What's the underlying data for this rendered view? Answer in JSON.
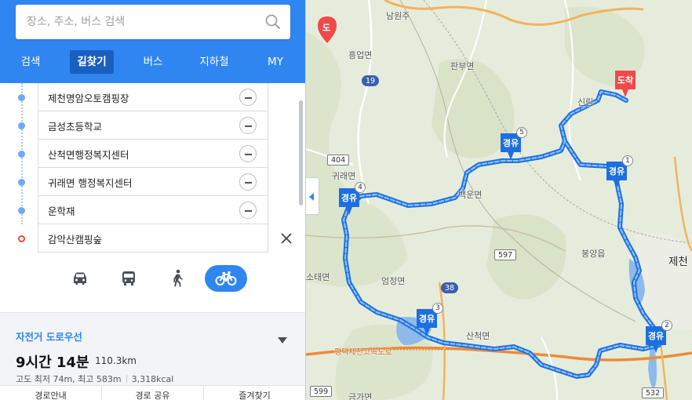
{
  "search": {
    "placeholder": "장소, 주소, 버스 검색"
  },
  "tabs": [
    {
      "label": "검색"
    },
    {
      "label": "길찾기"
    },
    {
      "label": "버스"
    },
    {
      "label": "지하철"
    },
    {
      "label": "MY"
    }
  ],
  "active_tab": "길찾기",
  "waypoints": [
    {
      "label": "제천명암오토캠핑장",
      "type": "via"
    },
    {
      "label": "금성초등학교",
      "type": "via"
    },
    {
      "label": "산척면행정복지센터",
      "type": "via"
    },
    {
      "label": "귀래면 행정복지센터",
      "type": "via"
    },
    {
      "label": "운학재",
      "type": "via"
    },
    {
      "label": "감악산캠핑숲",
      "type": "destination"
    }
  ],
  "modes": [
    {
      "name": "car",
      "icon": "car-icon",
      "active": false
    },
    {
      "name": "bus",
      "icon": "bus-icon",
      "active": false
    },
    {
      "name": "walk",
      "icon": "walk-icon",
      "active": false
    },
    {
      "name": "bike",
      "icon": "bike-icon",
      "active": true
    }
  ],
  "result": {
    "route_name": "자전거 도로우선",
    "time": "9시간 14분",
    "distance": "110.3km",
    "elevation": "고도 최저 74m, 최고 583m",
    "calories": "3,318kcal",
    "actions": [
      "경로안내",
      "경로 공유",
      "즐겨찾기"
    ]
  },
  "map": {
    "dest_button_label": "도",
    "labels": [
      {
        "text": "남원주",
        "kind": "town"
      },
      {
        "text": "흥업면",
        "kind": "town"
      },
      {
        "text": "판부면",
        "kind": "town"
      },
      {
        "text": "신림",
        "kind": "town"
      },
      {
        "text": "귀래면",
        "kind": "town"
      },
      {
        "text": "백운면",
        "kind": "town"
      },
      {
        "text": "봉양읍",
        "kind": "town"
      },
      {
        "text": "제천",
        "kind": "city"
      },
      {
        "text": "소태면",
        "kind": "town"
      },
      {
        "text": "엄정면",
        "kind": "town"
      },
      {
        "text": "산척면",
        "kind": "town"
      },
      {
        "text": "평택제천고속도로",
        "kind": "highway"
      },
      {
        "text": "금가면",
        "kind": "town"
      }
    ],
    "roads": [
      "19",
      "404",
      "597",
      "38",
      "599",
      "532"
    ],
    "pins": [
      {
        "label": "도착",
        "number": ""
      },
      {
        "label": "경유",
        "number": "1"
      },
      {
        "label": "경유",
        "number": "2"
      },
      {
        "label": "경유",
        "number": "3"
      },
      {
        "label": "경유",
        "number": "4"
      },
      {
        "label": "경유",
        "number": "5"
      }
    ],
    "colors": {
      "route": "#3d8ff2",
      "pin": "#1d6fe0",
      "dest_pin": "#ef4a4a",
      "topbar": "#2f86f0"
    }
  }
}
